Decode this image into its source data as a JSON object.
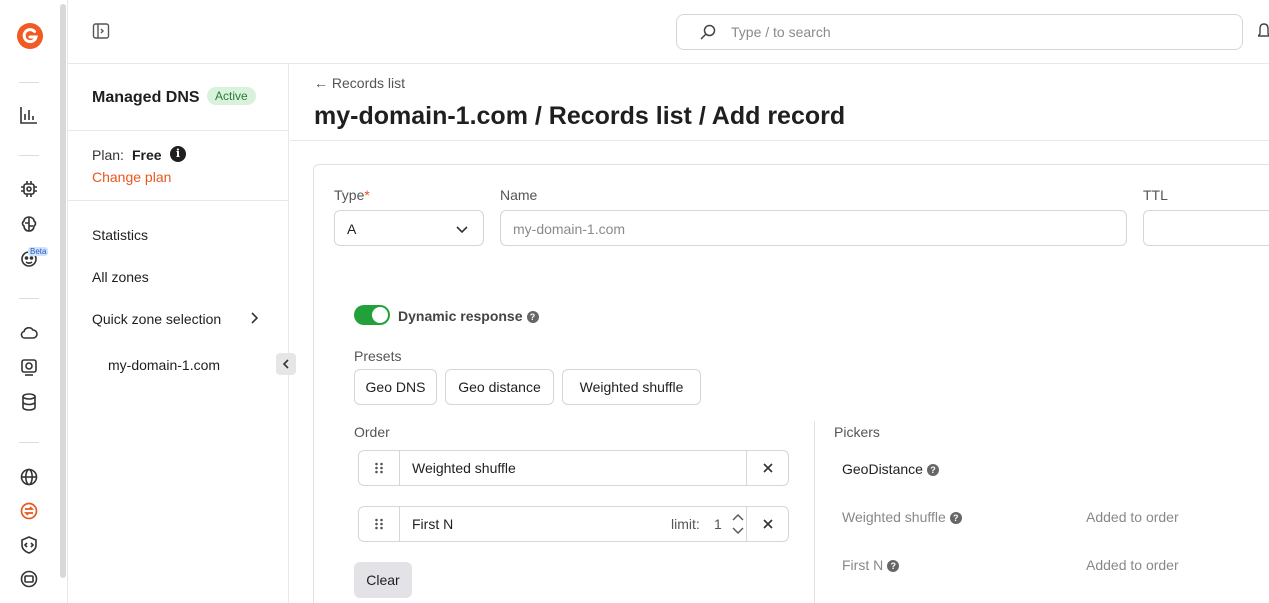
{
  "search": {
    "placeholder": "Type / to search"
  },
  "rail": {
    "beta_badge": "Beta"
  },
  "sidebar": {
    "title": "Managed DNS",
    "status_badge": "Active",
    "plan_label": "Plan:",
    "plan_value": "Free",
    "change_plan": "Change plan",
    "nav": [
      "Statistics",
      "All zones",
      "Quick zone selection"
    ],
    "zone": "my-domain-1.com"
  },
  "main": {
    "back_link": "← Records list",
    "title": "my-domain-1.com / Records list / Add record",
    "form": {
      "type_label": "Type",
      "required_mark": "*",
      "type_value": "A",
      "name_label": "Name",
      "name_placeholder": "my-domain-1.com",
      "ttl_label": "TTL"
    },
    "dynamic_response": {
      "label": "Dynamic response",
      "enabled": true
    },
    "presets": {
      "label": "Presets",
      "items": [
        "Geo DNS",
        "Geo distance",
        "Weighted shuffle"
      ]
    },
    "order": {
      "label": "Order",
      "rows": [
        {
          "name": "Weighted shuffle"
        },
        {
          "name": "First N",
          "limit_label": "limit:",
          "limit_value": "1"
        }
      ],
      "clear_label": "Clear"
    },
    "pickers": {
      "label": "Pickers",
      "items": [
        {
          "name": "GeoDistance",
          "status": ""
        },
        {
          "name": "Weighted shuffle",
          "status": "Added to order"
        },
        {
          "name": "First N",
          "status": "Added to order"
        }
      ]
    }
  },
  "colors": {
    "accent": "#e8571e",
    "toggle_on": "#22a03a",
    "badge_bg": "#d9f2dc"
  }
}
